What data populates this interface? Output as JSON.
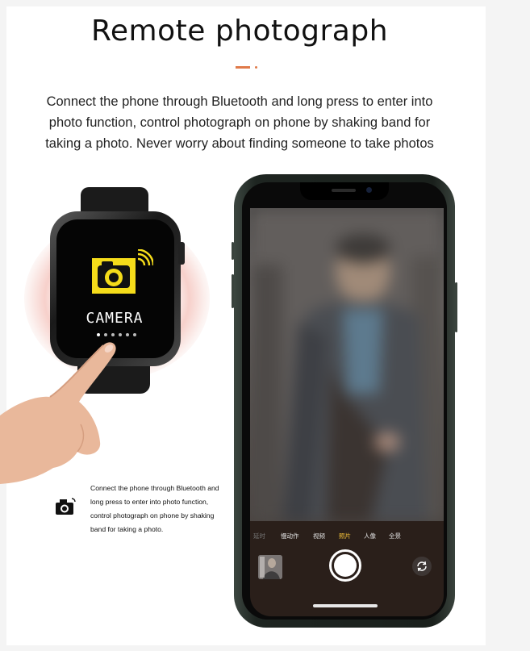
{
  "title": "Remote photograph",
  "description": "Connect the phone through Bluetooth and long press to enter into photo function, control photograph on phone by shaking band for taking a photo. Never worry about finding someone to take photos",
  "description_lines": [
    "Connect the phone through Bluetooth and long press to enter into",
    "photo function, control photograph on phone by shaking band for",
    "taking a photo. Never worry about finding someone to take photos"
  ],
  "watch": {
    "screen_label": "CAMERA",
    "icon": "camera-icon",
    "accent": "#f5dc1a"
  },
  "small_caption_lines": [
    "Connect the phone through Bluetooth and",
    "long press to enter into photo function,",
    "control photograph on phone by shaking",
    "band for taking a photo."
  ],
  "phone": {
    "camera_modes": [
      "延时",
      "慢动作",
      "视频",
      "照片",
      "人像",
      "全景"
    ],
    "active_mode": "照片",
    "active_mode_color": "#f5c23a"
  },
  "colors": {
    "accent": "#e07a4a",
    "phone_frame": "#1e2521"
  }
}
